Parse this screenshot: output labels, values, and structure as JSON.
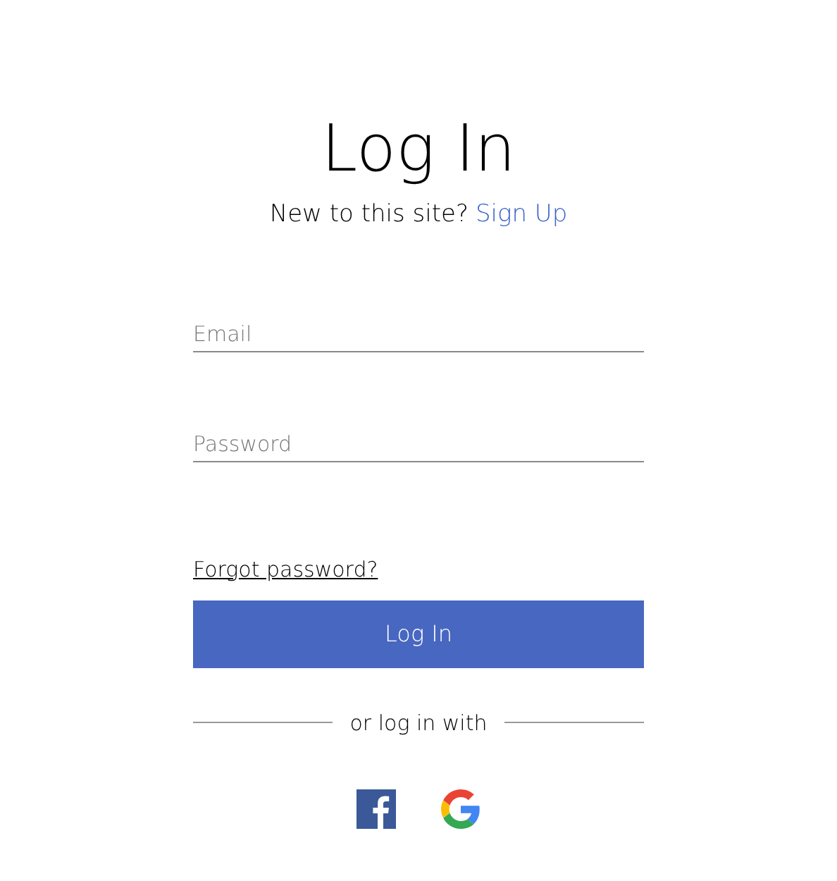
{
  "title": "Log In",
  "signup": {
    "prompt": "New to this site?",
    "link": "Sign Up"
  },
  "fields": [
    {
      "placeholder": "Email"
    },
    {
      "placeholder": "Password"
    }
  ],
  "forgot_link": "Forgot password?",
  "submit_button": "Log In",
  "divider_text": "or log in with",
  "social": [
    {
      "kind": "facebook"
    },
    {
      "kind": "google"
    }
  ]
}
